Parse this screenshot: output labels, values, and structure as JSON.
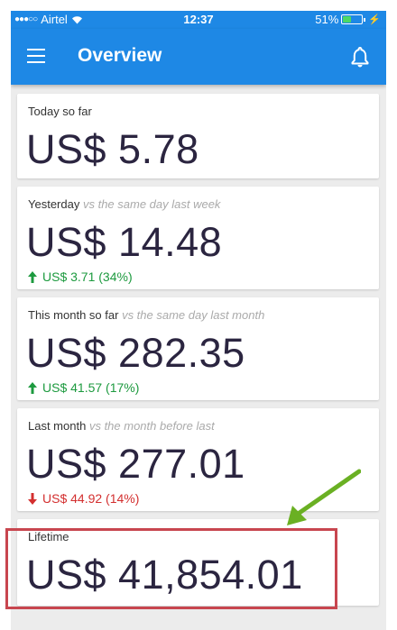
{
  "status_bar": {
    "carrier": "Airtel",
    "time": "12:37",
    "battery": "51%",
    "battery_level": 0.51
  },
  "app_bar": {
    "title": "Overview"
  },
  "cards": [
    {
      "label": "Today so far",
      "comparison": "",
      "value": "US$ 5.78",
      "change": ""
    },
    {
      "label": "Yesterday",
      "comparison": "vs the same day last week",
      "value": "US$ 14.48",
      "change": "US$ 3.71 (34%)",
      "direction": "up"
    },
    {
      "label": "This month so far",
      "comparison": "vs the same day last month",
      "value": "US$ 282.35",
      "change": "US$ 41.57 (17%)",
      "direction": "up"
    },
    {
      "label": "Last month",
      "comparison": "vs the month before last",
      "value": "US$ 277.01",
      "change": "US$ 44.92 (14%)",
      "direction": "down"
    },
    {
      "label": "Lifetime",
      "comparison": "",
      "value": "US$ 41,854.01",
      "change": ""
    }
  ],
  "colors": {
    "app_bar": "#1e88e5",
    "positive": "#1d9a3f",
    "negative": "#d32f2f",
    "highlight_box": "#c8464f",
    "pointer_arrow": "#6ab023"
  },
  "icons": [
    "signal-dots-icon",
    "wifi-icon",
    "battery-icon",
    "charging-bolt-icon",
    "menu-icon",
    "bell-icon",
    "arrow-up-icon",
    "arrow-down-icon"
  ]
}
